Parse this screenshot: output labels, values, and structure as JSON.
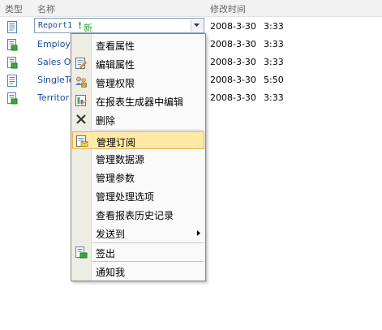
{
  "headers": {
    "type": "类型",
    "name": "名称",
    "modified": "修改时间"
  },
  "rows": [
    {
      "name": "Report1",
      "date": "2008-3-30",
      "time": "3:33",
      "icon": "report-icon"
    },
    {
      "name": "Employe",
      "date": "2008-3-30",
      "time": "3:33",
      "icon": "datasource-report-icon"
    },
    {
      "name": "Sales O",
      "date": "2008-3-30",
      "time": "3:33",
      "icon": "datasource-report-icon"
    },
    {
      "name": "SingleTe",
      "date": "2008-3-30",
      "time": "5:50",
      "icon": "report-icon"
    },
    {
      "name": "Territor",
      "date": "2008-3-30",
      "time": "3:33",
      "icon": "datasource-report-icon"
    }
  ],
  "new_badge": "新",
  "new_mark": "!",
  "menu": {
    "items": [
      {
        "label": "查看属性",
        "icon": ""
      },
      {
        "label": "编辑属性",
        "icon": "edit-properties-icon"
      },
      {
        "label": "管理权限",
        "icon": "permissions-icon"
      },
      {
        "label": "在报表生成器中编辑",
        "icon": "report-builder-icon"
      },
      {
        "label": "删除",
        "icon": "delete-icon"
      },
      {
        "label": "管理订阅",
        "icon": "subscription-icon"
      },
      {
        "label": "管理数据源",
        "icon": ""
      },
      {
        "label": "管理参数",
        "icon": ""
      },
      {
        "label": "管理处理选项",
        "icon": ""
      },
      {
        "label": "查看报表历史记录",
        "icon": ""
      },
      {
        "label": "发送到",
        "icon": ""
      },
      {
        "label": "签出",
        "icon": "checkout-icon"
      },
      {
        "label": "通知我",
        "icon": ""
      }
    ]
  },
  "colors": {
    "accent": "#1a4d99",
    "highlight": "#ffe9a8",
    "highlight_border": "#e8b54a",
    "new_green": "#2e9e2e"
  }
}
